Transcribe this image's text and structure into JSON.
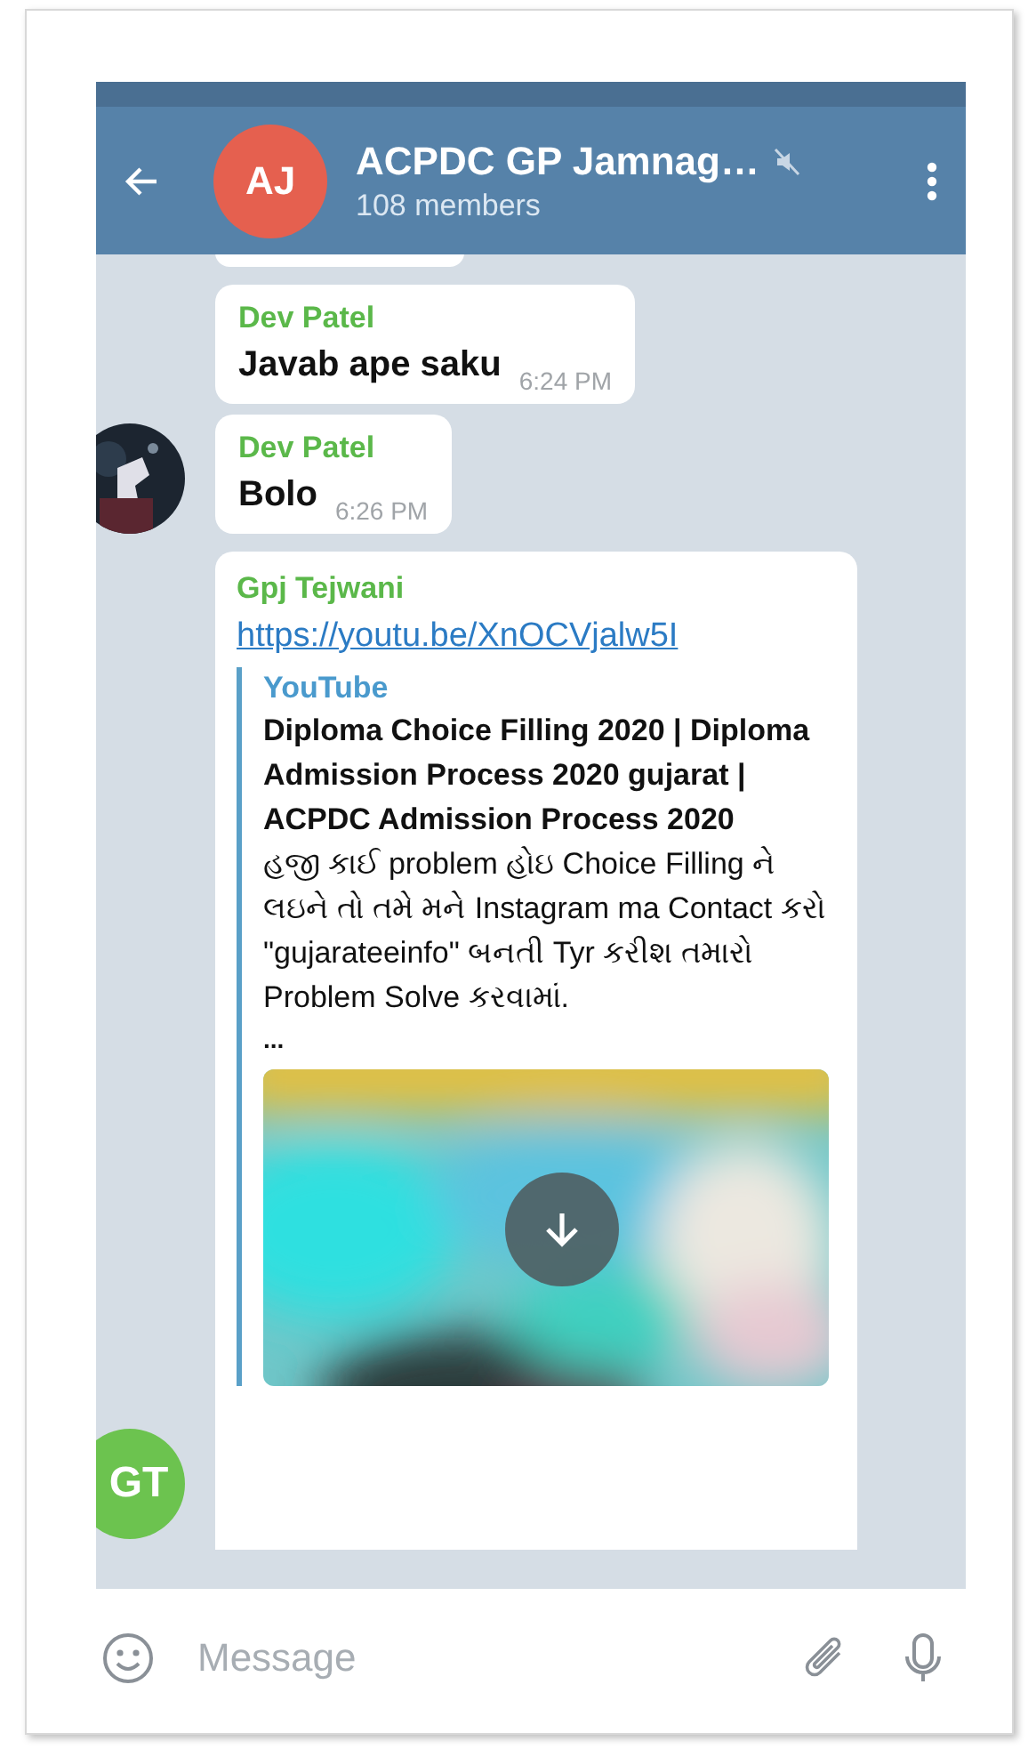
{
  "header": {
    "title": "ACPDC GP Jamnag…",
    "subtitle": "108 members",
    "avatar": {
      "initials": "AJ",
      "color": "#e5604f"
    },
    "muted": true
  },
  "messages": [
    {
      "kind": "fragment"
    },
    {
      "kind": "text",
      "sender": "Dev Patel",
      "text": "Javab ape saku",
      "time": "6:24 PM"
    },
    {
      "kind": "text",
      "sender": "Dev Patel",
      "text": "Bolo",
      "time": "6:26 PM"
    },
    {
      "kind": "link",
      "sender": "Gpj Tejwani",
      "url": "https://youtu.be/XnOCVjalw5I",
      "preview": {
        "site": "YouTube",
        "title": "Diploma Choice Filling 2020 | Diploma Admission Process 2020 gujarat | ACPDC Admission Process 2020",
        "description": "હજી કાઈ problem હોઇ Choice Filling ને લઇને તો તમે મને Instagram ma Contact કરો \"gujarateeinfo\" બનતી Tyr કરીશ તમારો Problem Solve કરવામાં.",
        "more": "..."
      },
      "avatar": {
        "initials": "GT",
        "color": "#6cc34f"
      }
    }
  ],
  "composer": {
    "placeholder": "Message"
  }
}
